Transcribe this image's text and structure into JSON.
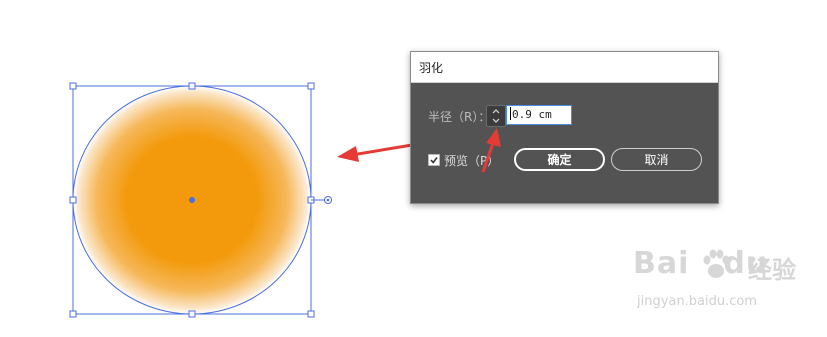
{
  "dialog": {
    "title": "羽化",
    "radius_label": "半径（R）：",
    "radius_value": "0.9 cm",
    "preview_label": "预览（P）",
    "preview_checked": true,
    "ok_label": "确定",
    "cancel_label": "取消"
  },
  "artboard": {
    "circle_fill_color": "#f39a0c",
    "selection_color": "#4a6fe0",
    "annotation_arrow_color": "#e53a36"
  },
  "watermark": {
    "brand": "Bai",
    "brand_suffix": "du",
    "site_name": "经验",
    "url": "jingyan.baidu.com"
  }
}
